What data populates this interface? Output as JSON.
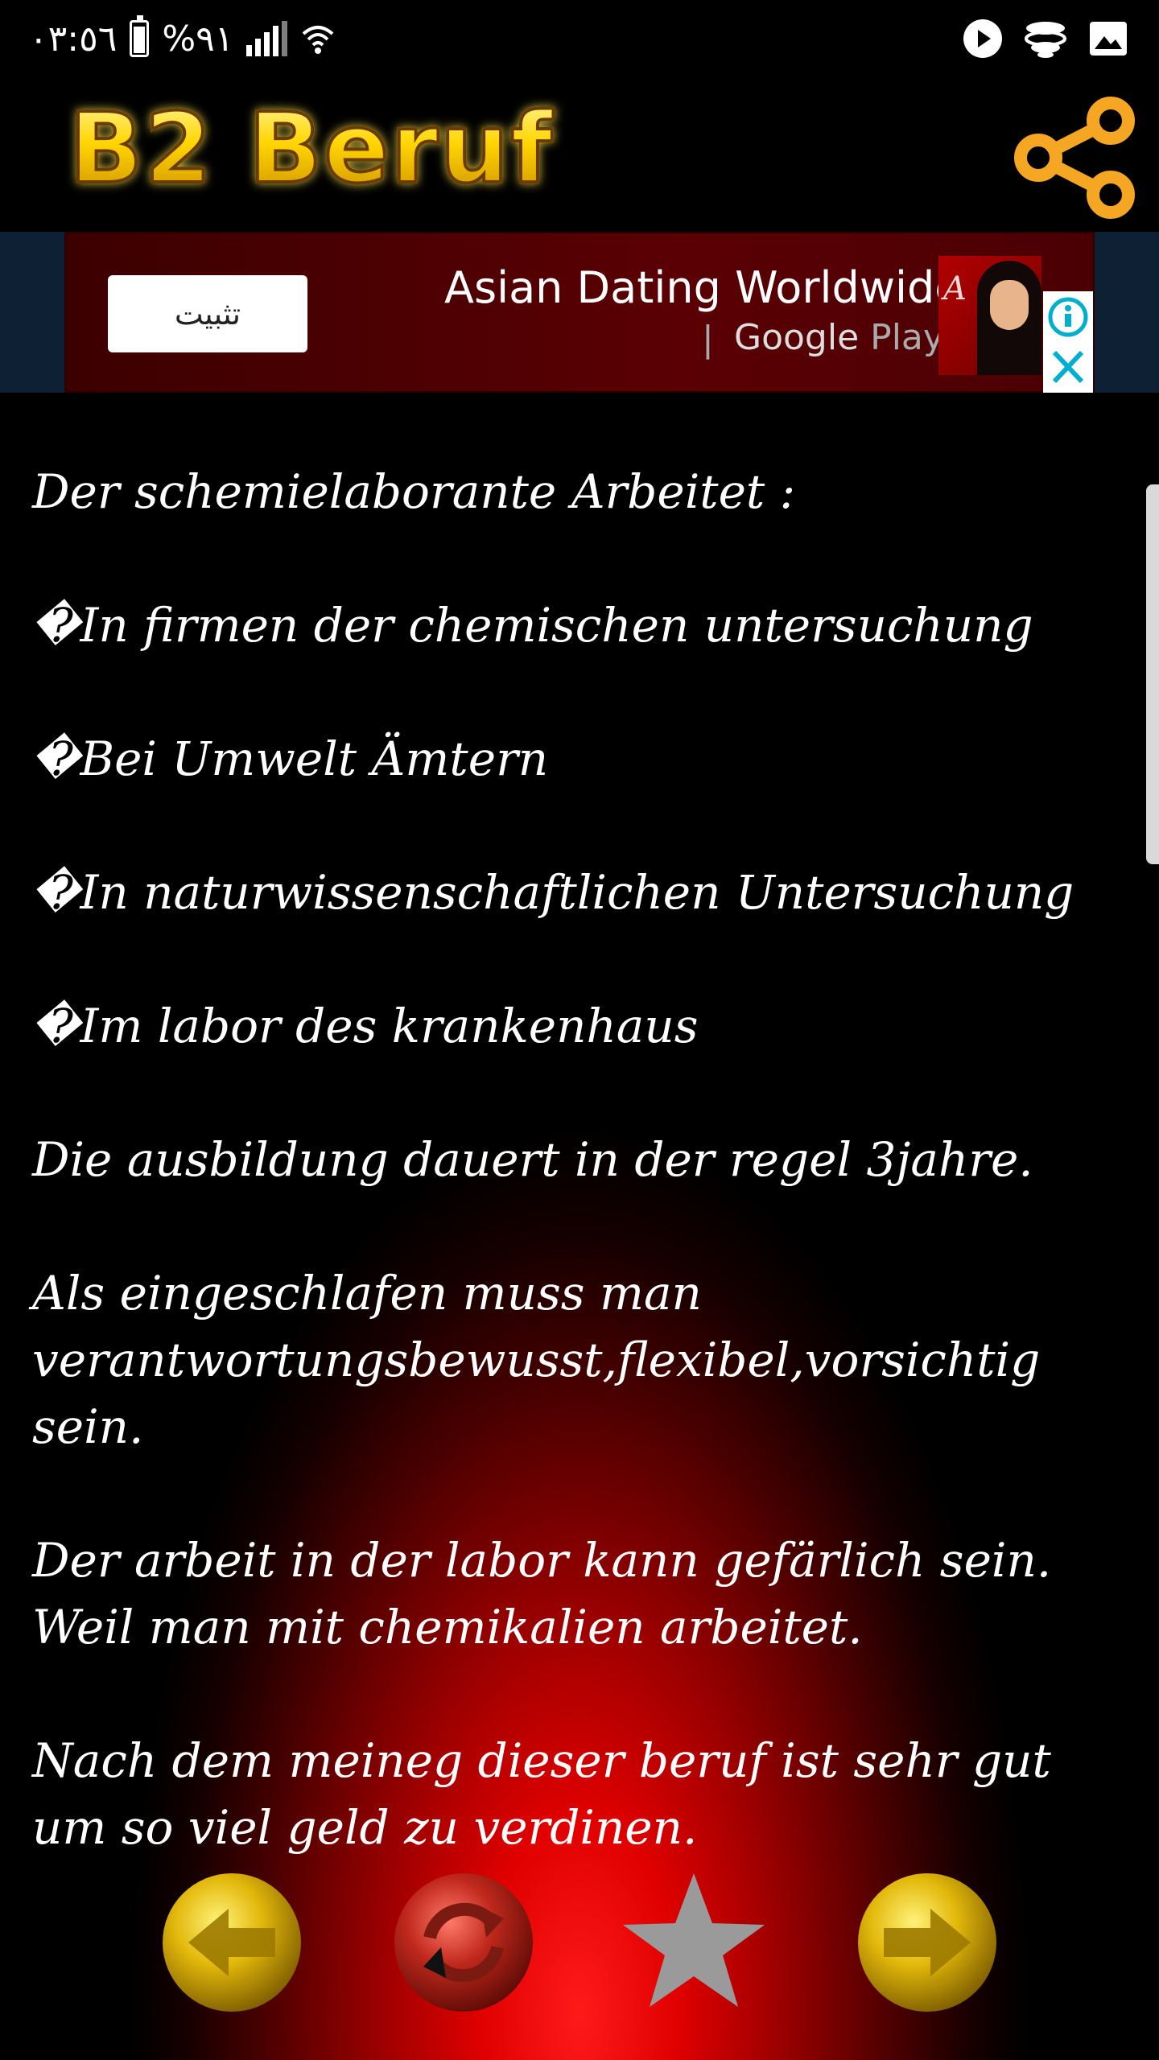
{
  "status_bar": {
    "time": "٠٣:٥٦",
    "battery_text": "%٩١",
    "battery_level": 0.91,
    "icons": [
      "battery-icon",
      "signal-icon",
      "wifi-icon",
      "video-icon",
      "cloud-icon",
      "gallery-icon"
    ]
  },
  "app_bar": {
    "title": "B2 Beruf",
    "title_color": "#FFD700",
    "share_icon": "share-icon",
    "accent": "#F5A623"
  },
  "ad": {
    "install_label": "تثبيت",
    "title": "Asian Dating Worldwide",
    "store_prefix": "Google",
    "store_suffix": "Play",
    "divider": "|",
    "thumb_monogram": "A",
    "info_icon": "info-icon",
    "close_icon": "close-icon",
    "accent": "#00AECD"
  },
  "content": {
    "paragraphs": [
      "Der schemielaborante Arbeitet :",
      "�In firmen der chemischen untersuchung",
      "�Bei Umwelt Ämtern",
      "�In naturwissenschaftlichen Untersuchung",
      "�Im labor des krankenhaus",
      "Die ausbildung dauert in der regel 3jahre.",
      "Als eingeschlafen muss man verantwortungsbewusst,flexibel,vorsichtig sein.",
      "Der arbeit in der labor kann gefärlich sein. Weil man mit chemikalien arbeitet.",
      "Nach dem meineg dieser beruf ist sehr gut um so viel geld zu verdinen."
    ]
  },
  "controls": {
    "icons": [
      "arrow-left-icon",
      "refresh-icon",
      "star-icon",
      "arrow-right-icon"
    ],
    "colors": {
      "gold": "#E2B80A",
      "red": "#B81A12",
      "star": "#9A9A9A"
    }
  }
}
